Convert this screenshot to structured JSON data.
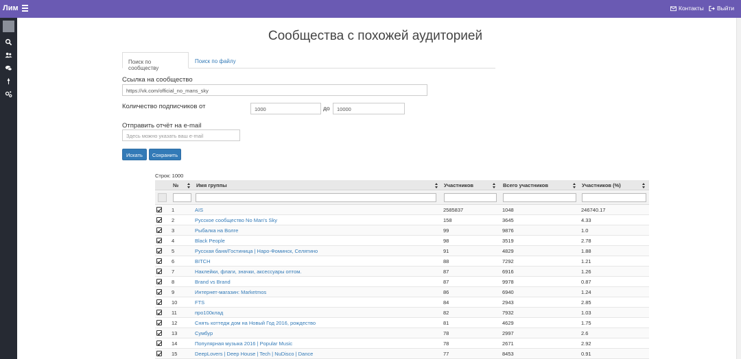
{
  "topbar": {
    "brand": "Лим",
    "contacts": "Контакты",
    "logout": "Выйти"
  },
  "page": {
    "title": "Сообщества с похожей аудиторией"
  },
  "tabs": [
    {
      "label": "Поиск по сообществу",
      "active": true
    },
    {
      "label": "Поиск по файлу",
      "active": false
    }
  ],
  "form": {
    "community_link_label": "Ссылка на сообщество",
    "community_link_value": "https://vk.com/official_no_mans_sky",
    "subscribers_label": "Количество подписчиков от",
    "subscribers_from": "1000",
    "to_label": "до",
    "subscribers_to": "10000",
    "email_label": "Отправить отчёт на e-mail",
    "email_placeholder": "Здесь можно указать ваш e-mail",
    "search_button": "Искать",
    "save_button": "Сохранить"
  },
  "table": {
    "rows_count": "Строк: 1000",
    "columns": [
      "№",
      "Имя группы",
      "Участников",
      "Всего участников",
      "Участников (%)"
    ],
    "rows": [
      {
        "n": "1",
        "name": "AIS",
        "members": "2585837",
        "total": "1048",
        "percent": "246740.17"
      },
      {
        "n": "2",
        "name": "Русское сообщество No Man's Sky",
        "members": "158",
        "total": "3645",
        "percent": "4.33"
      },
      {
        "n": "3",
        "name": "Рыбалка на Волге",
        "members": "99",
        "total": "9876",
        "percent": "1.0"
      },
      {
        "n": "4",
        "name": "Black People",
        "members": "98",
        "total": "3519",
        "percent": "2.78"
      },
      {
        "n": "5",
        "name": "Русская баня/Гостиница | Наро-Фоминск, Селятино",
        "members": "91",
        "total": "4829",
        "percent": "1.88"
      },
      {
        "n": "6",
        "name": "BITCH",
        "members": "88",
        "total": "7292",
        "percent": "1.21"
      },
      {
        "n": "7",
        "name": "Наклейки, флаги, значки, аксессуары оптом.",
        "members": "87",
        "total": "6916",
        "percent": "1.26"
      },
      {
        "n": "8",
        "name": "Brand vs Brand",
        "members": "87",
        "total": "9978",
        "percent": "0.87"
      },
      {
        "n": "9",
        "name": "Интернет-магазин: Marketmos",
        "members": "86",
        "total": "6940",
        "percent": "1.24"
      },
      {
        "n": "10",
        "name": "FTS",
        "members": "84",
        "total": "2943",
        "percent": "2.85"
      },
      {
        "n": "11",
        "name": "про100клад",
        "members": "82",
        "total": "7932",
        "percent": "1.03"
      },
      {
        "n": "12",
        "name": "Снять коттедж дом на Новый Год 2016, рождество",
        "members": "81",
        "total": "4629",
        "percent": "1.75"
      },
      {
        "n": "13",
        "name": "Сумбур",
        "members": "78",
        "total": "2997",
        "percent": "2.6"
      },
      {
        "n": "14",
        "name": "Популярная музыка 2016 | Popular Music",
        "members": "78",
        "total": "2671",
        "percent": "2.92"
      },
      {
        "n": "15",
        "name": "DeepLovers | Deep House | Tech | NuDisco | Dance",
        "members": "77",
        "total": "8453",
        "percent": "0.91"
      }
    ]
  },
  "icons": {
    "sidebar": [
      "search-icon",
      "users-icon",
      "chat-icon",
      "pin-icon",
      "settings-icon"
    ],
    "topbar": [
      "menu-icon",
      "mail-icon",
      "logout-icon"
    ]
  },
  "colors": {
    "topbar": "#6a5ab3",
    "sidebar": "#262a33",
    "accent": "#337ab7"
  }
}
